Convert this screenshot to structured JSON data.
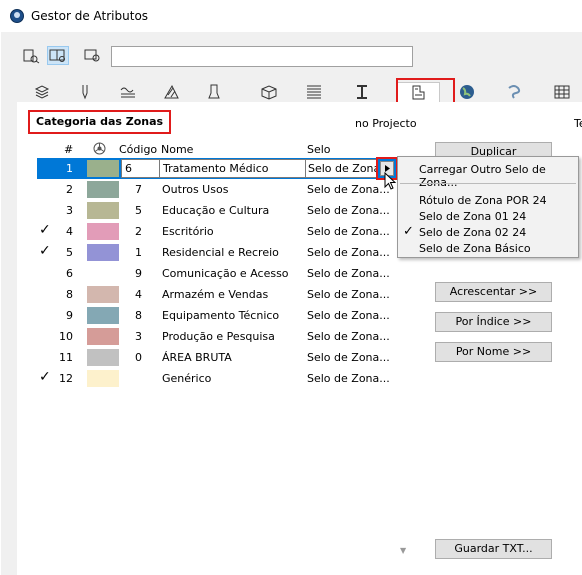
{
  "window": {
    "title": "Gestor de Atributos"
  },
  "toolbar": {
    "search_value": ""
  },
  "tabs": [
    {
      "name": "layers-tab-icon"
    },
    {
      "name": "pens-tab-icon"
    },
    {
      "name": "linetypes-tab-icon"
    },
    {
      "name": "fills-tab-icon"
    },
    {
      "name": "composites-tab-icon"
    },
    {
      "name": "building-materials-tab-icon"
    },
    {
      "name": "profiles-tab-icon"
    },
    {
      "name": "profile-beam-tab-icon"
    },
    {
      "name": "zone-categories-tab-icon"
    },
    {
      "name": "surfaces-tab-icon"
    },
    {
      "name": "mep-tab-icon"
    },
    {
      "name": "grid-tab-icon"
    }
  ],
  "panel": {
    "category_label": "Categoria das Zonas",
    "in_project_label": "no Projecto",
    "right_label": "Te"
  },
  "table": {
    "headers": {
      "index": "#",
      "code": "Código",
      "name": "Nome",
      "stamp": "Selo"
    },
    "rows": [
      {
        "num": "1",
        "check": "",
        "color": "#9ab08c",
        "code": "6",
        "name": "Tratamento Médico",
        "stamp": "Selo de Zona...",
        "selected": true
      },
      {
        "num": "2",
        "check": "",
        "color": "#8da79a",
        "code": "7",
        "name": "Outros Usos",
        "stamp": "Selo de Zona..."
      },
      {
        "num": "3",
        "check": "",
        "color": "#b7b794",
        "code": "5",
        "name": "Educação e Cultura",
        "stamp": "Selo de Zona..."
      },
      {
        "num": "4",
        "check": "✓",
        "color": "#e29cb8",
        "code": "2",
        "name": "Escritório",
        "stamp": "Selo de Zona..."
      },
      {
        "num": "5",
        "check": "✓",
        "color": "#9393d6",
        "code": "1",
        "name": "Residencial e Recreio",
        "stamp": "Selo de Zona..."
      },
      {
        "num": "6",
        "check": "",
        "color": "#ffffff",
        "code": "9",
        "name": "Comunicação e Acesso",
        "stamp": "Selo de Zona..."
      },
      {
        "num": "8",
        "check": "",
        "color": "#d3b7ae",
        "code": "4",
        "name": "Armazém e Vendas",
        "stamp": "Selo de Zona..."
      },
      {
        "num": "9",
        "check": "",
        "color": "#84a8b4",
        "code": "8",
        "name": "Equipamento Técnico",
        "stamp": "Selo de Zona..."
      },
      {
        "num": "10",
        "check": "",
        "color": "#d59c98",
        "code": "3",
        "name": "Produção e Pesquisa",
        "stamp": "Selo de Zona..."
      },
      {
        "num": "11",
        "check": "",
        "color": "#c1c1c1",
        "code": "0",
        "name": "ÁREA BRUTA",
        "stamp": "Selo de Zona..."
      },
      {
        "num": "12",
        "check": "✓",
        "color": "#fdf1cc",
        "code": "",
        "name": "Genérico",
        "stamp": "Selo de Zona..."
      }
    ]
  },
  "buttons": {
    "duplicate": "Duplicar",
    "append": "Acrescentar >>",
    "by_index": "Por Índice >>",
    "by_name": "Por Nome >>",
    "save_txt": "Guardar TXT..."
  },
  "context_menu": {
    "load_other": "Carregar Outro Selo de Zona...",
    "items": [
      {
        "label": "Rótulo de Zona POR 24",
        "checked": ""
      },
      {
        "label": "Selo de Zona 01 24",
        "checked": ""
      },
      {
        "label": "Selo de Zona 02 24",
        "checked": "✓"
      },
      {
        "label": "Selo de Zona Básico",
        "checked": ""
      }
    ]
  }
}
